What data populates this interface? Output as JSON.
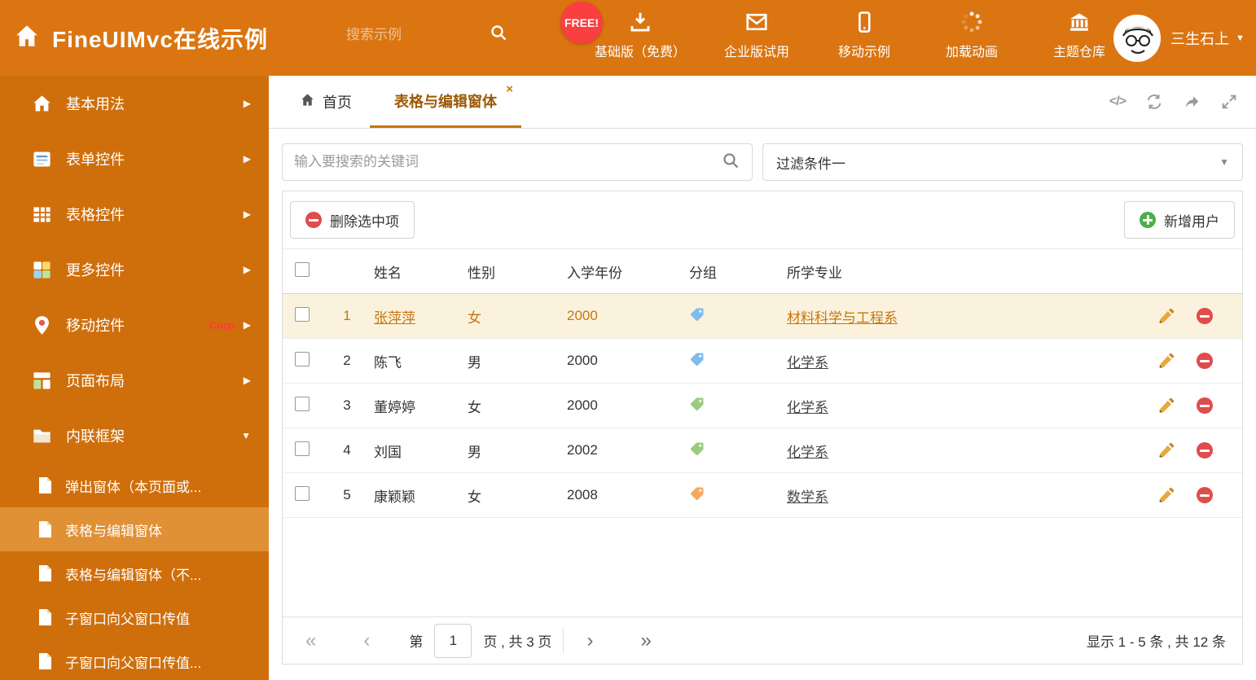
{
  "colors": {
    "header_bg": "#DB7511",
    "sidebar_bg": "#CF6F0C",
    "active_bg": "#E09136",
    "accent": "#C4770E",
    "selected_bg": "#FBF2DE",
    "badge_red": "#F93F3F"
  },
  "header": {
    "title": "FineUIMvc在线示例",
    "search_placeholder": "搜索示例",
    "free_badge": "FREE!",
    "nav_items": [
      {
        "label": "基础版（免费）",
        "icon": "download-icon"
      },
      {
        "label": "企业版试用",
        "icon": "mail-icon"
      },
      {
        "label": "移动示例",
        "icon": "mobile-icon"
      },
      {
        "label": "加载动画",
        "icon": "spinner-icon"
      },
      {
        "label": "主题仓库",
        "icon": "bank-icon"
      }
    ],
    "user_name": "三生石上"
  },
  "sidebar": {
    "items": [
      {
        "label": "基本用法",
        "arrow": "▶"
      },
      {
        "label": "表单控件",
        "arrow": "▶"
      },
      {
        "label": "表格控件",
        "arrow": "▶"
      },
      {
        "label": "更多控件",
        "arrow": "▶"
      },
      {
        "label": "移动控件",
        "badge": "Corp.",
        "arrow": "▶"
      },
      {
        "label": "页面布局",
        "arrow": "▶"
      },
      {
        "label": "内联框架",
        "arrow": "▼"
      }
    ],
    "subitems": [
      {
        "label": "弹出窗体（本页面或...",
        "item_class": "sub-item"
      },
      {
        "label": "表格与编辑窗体",
        "item_class": "sub-item active"
      },
      {
        "label": "表格与编辑窗体（不...",
        "item_class": "sub-item"
      },
      {
        "label": "子窗口向父窗口传值",
        "item_class": "sub-item"
      },
      {
        "label": "子窗口向父窗口传值...",
        "item_class": "sub-item"
      }
    ]
  },
  "tabs": {
    "home": "首页",
    "active": "表格与编辑窗体"
  },
  "icons": {
    "code": "</>",
    "close": "×",
    "caret_down": "▼",
    "first_page": "«",
    "prev_page": "‹",
    "next_page": "›",
    "last_page": "»"
  },
  "filters": {
    "search_placeholder": "输入要搜索的关键词",
    "filter_value": "过滤条件一"
  },
  "toolbar": {
    "delete_label": "删除选中项",
    "add_label": "新增用户"
  },
  "table": {
    "columns": [
      "姓名",
      "性别",
      "入学年份",
      "分组",
      "所学专业"
    ],
    "rows": [
      {
        "num": "1",
        "name": "张萍萍",
        "gender": "女",
        "year": "2000",
        "tag_class": "tag tag-blue",
        "major": "材料科学与工程系",
        "row_class": "trow selected"
      },
      {
        "num": "2",
        "name": "陈飞",
        "gender": "男",
        "year": "2000",
        "tag_class": "tag tag-blue",
        "major": "化学系",
        "row_class": "trow"
      },
      {
        "num": "3",
        "name": "董婷婷",
        "gender": "女",
        "year": "2000",
        "tag_class": "tag tag-green",
        "major": "化学系",
        "row_class": "trow"
      },
      {
        "num": "4",
        "name": "刘国",
        "gender": "男",
        "year": "2002",
        "tag_class": "tag tag-green",
        "major": "化学系",
        "row_class": "trow"
      },
      {
        "num": "5",
        "name": "康颖颖",
        "gender": "女",
        "year": "2008",
        "tag_class": "tag tag-orange",
        "major": "数学系",
        "row_class": "trow"
      }
    ]
  },
  "pagination": {
    "page_prefix": "第",
    "current_page": "1",
    "page_suffix": "页 , 共 3 页",
    "summary": "显示 1 - 5 条 , 共 12 条"
  }
}
